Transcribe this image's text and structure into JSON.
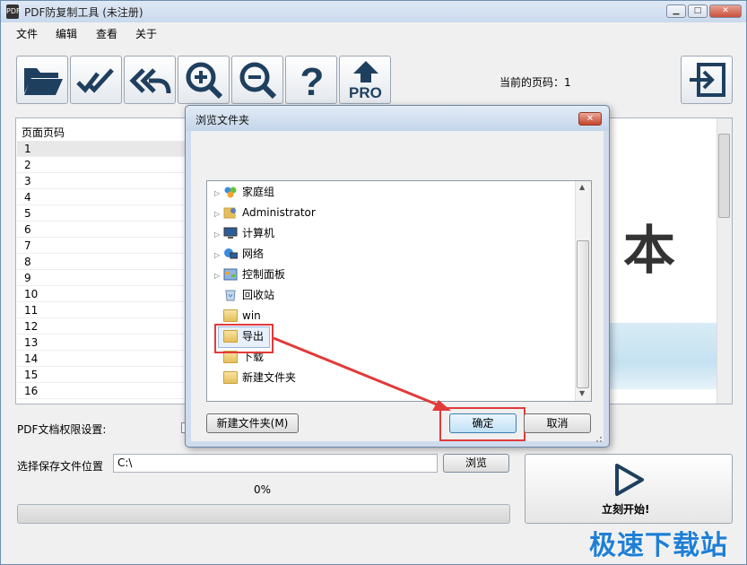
{
  "window": {
    "title": "PDF防复制工具 (未注册)",
    "controls": [
      "minimize",
      "maximize",
      "close"
    ]
  },
  "menu": [
    "文件",
    "编辑",
    "查看",
    "关于"
  ],
  "toolbar": {
    "buttons": [
      {
        "name": "open-folder-icon"
      },
      {
        "name": "double-check-icon"
      },
      {
        "name": "reply-all-icon"
      },
      {
        "name": "zoom-in-icon"
      },
      {
        "name": "zoom-out-icon"
      },
      {
        "name": "help-icon"
      },
      {
        "name": "pro-upgrade-icon",
        "label": "PRO"
      }
    ],
    "page_indicator": "当前的页码：1",
    "exit_icon": "exit-icon"
  },
  "page_list": {
    "header": "页面页码",
    "pages": [
      "1",
      "2",
      "3",
      "4",
      "5",
      "6",
      "7",
      "8",
      "9",
      "10",
      "11",
      "12",
      "13",
      "14",
      "15",
      "16"
    ],
    "selected": "1"
  },
  "preview": {
    "text": "本"
  },
  "settings": {
    "permission_label": "PDF文档权限设置:",
    "save_label": "选择保存文件位置",
    "save_path": "C:\\",
    "browse_label": "浏览"
  },
  "progress": {
    "text": "0%",
    "value": 0
  },
  "start": {
    "label": "立刻开始!",
    "icon": "play-icon"
  },
  "watermark": "极速下载站",
  "dialog": {
    "title": "浏览文件夹",
    "tree": [
      {
        "label": "家庭组",
        "icon": "homegroup-icon",
        "expandable": true
      },
      {
        "label": "Administrator",
        "icon": "user-folder-icon",
        "expandable": true
      },
      {
        "label": "计算机",
        "icon": "computer-icon",
        "expandable": true
      },
      {
        "label": "网络",
        "icon": "network-icon",
        "expandable": true
      },
      {
        "label": "控制面板",
        "icon": "control-panel-icon",
        "expandable": true
      },
      {
        "label": "回收站",
        "icon": "recycle-bin-icon",
        "expandable": false
      },
      {
        "label": "win",
        "icon": "folder-icon",
        "expandable": false
      },
      {
        "label": "导出",
        "icon": "folder-icon",
        "expandable": false,
        "selected": true
      },
      {
        "label": "下载",
        "icon": "folder-icon",
        "expandable": false
      },
      {
        "label": "新建文件夹",
        "icon": "folder-icon",
        "expandable": false
      }
    ],
    "new_folder_label": "新建文件夹(M)",
    "ok_label": "确定",
    "cancel_label": "取消"
  },
  "colors": {
    "annotation_red": "#e23a3a",
    "watermark_blue": "#1f7fd6",
    "selection_bg": "#e8f0fb"
  }
}
